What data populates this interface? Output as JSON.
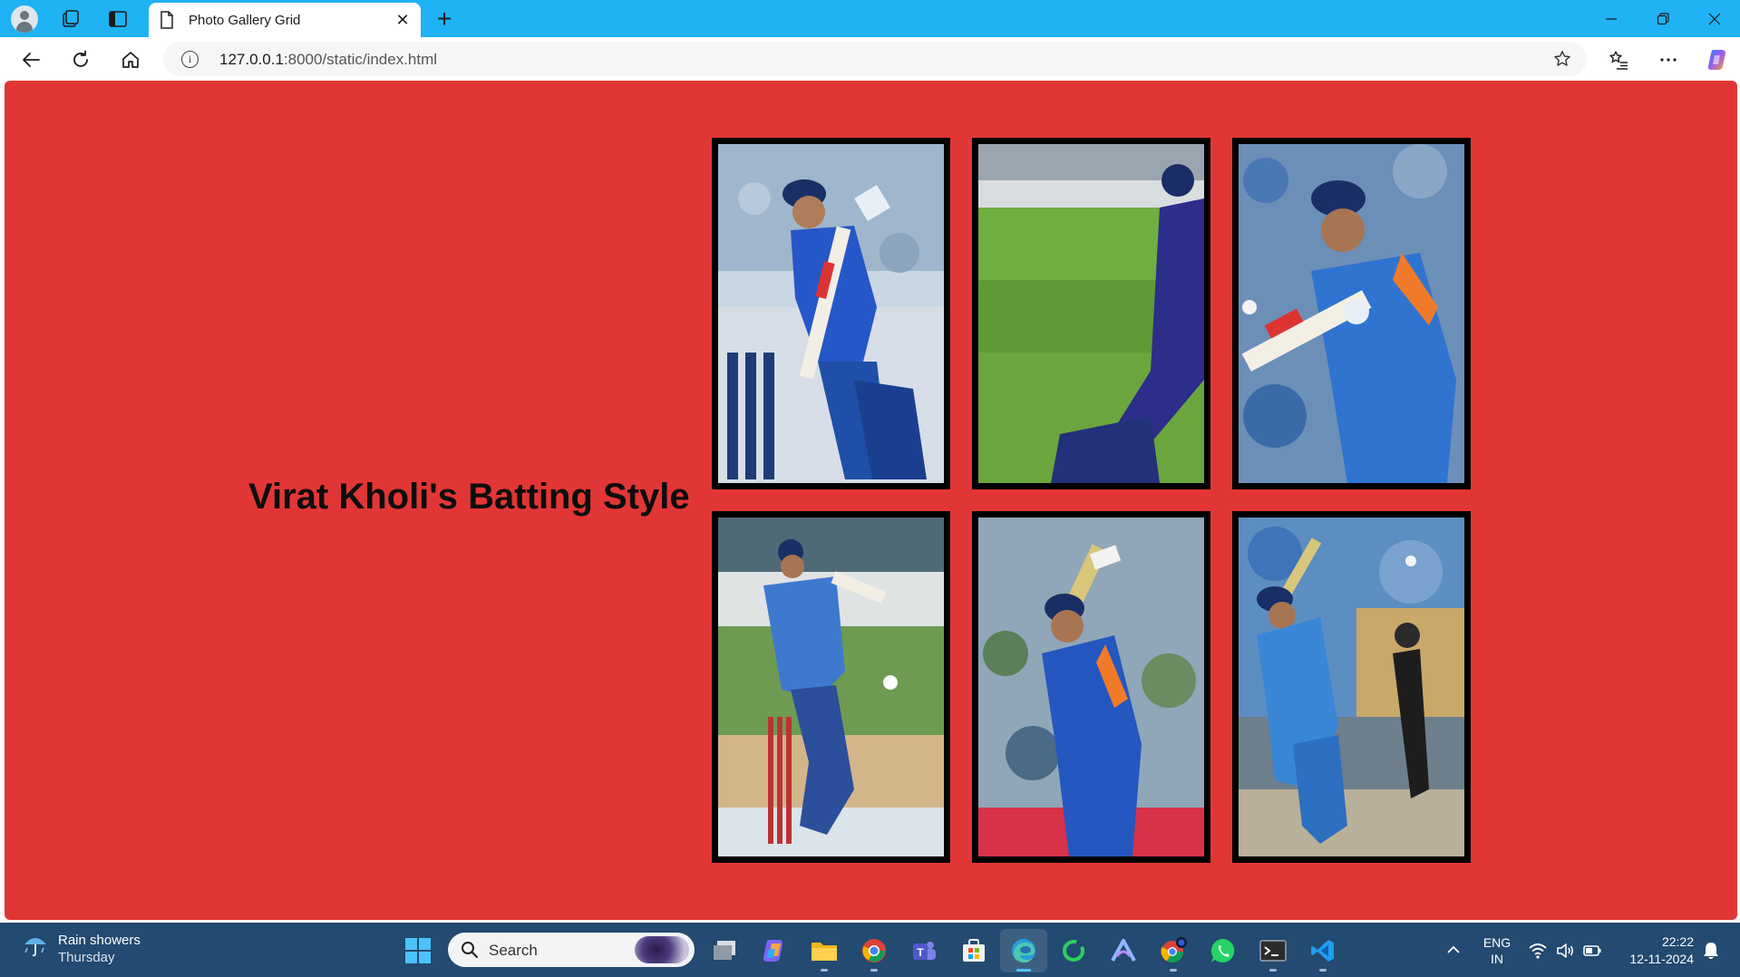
{
  "browser": {
    "tab_title": "Photo Gallery Grid",
    "url_host": "127.0.0.1",
    "url_path": ":8000/static/index.html"
  },
  "page": {
    "heading": "Virat Kholi's Batting Style",
    "background_color": "#e23636",
    "photos": [
      {
        "label": "batting-photo-1"
      },
      {
        "label": "batting-photo-2"
      },
      {
        "label": "batting-photo-3"
      },
      {
        "label": "batting-photo-4"
      },
      {
        "label": "batting-photo-5"
      },
      {
        "label": "batting-photo-6"
      }
    ]
  },
  "taskbar": {
    "weather_title": "Rain showers",
    "weather_day": "Thursday",
    "search_placeholder": "Search",
    "lang_line1": "ENG",
    "lang_line2": "IN",
    "time": "22:22",
    "date": "12-11-2024",
    "apps": [
      "copilot-app",
      "file-explorer",
      "chrome",
      "teams",
      "microsoft-store",
      "edge",
      "app-green-ring",
      "app-arc",
      "chrome-profile",
      "whatsapp",
      "terminal",
      "vscode"
    ]
  },
  "colors": {
    "titlebar": "#1fb2f5",
    "taskbar": "#234a70",
    "accent": "#e23636"
  }
}
